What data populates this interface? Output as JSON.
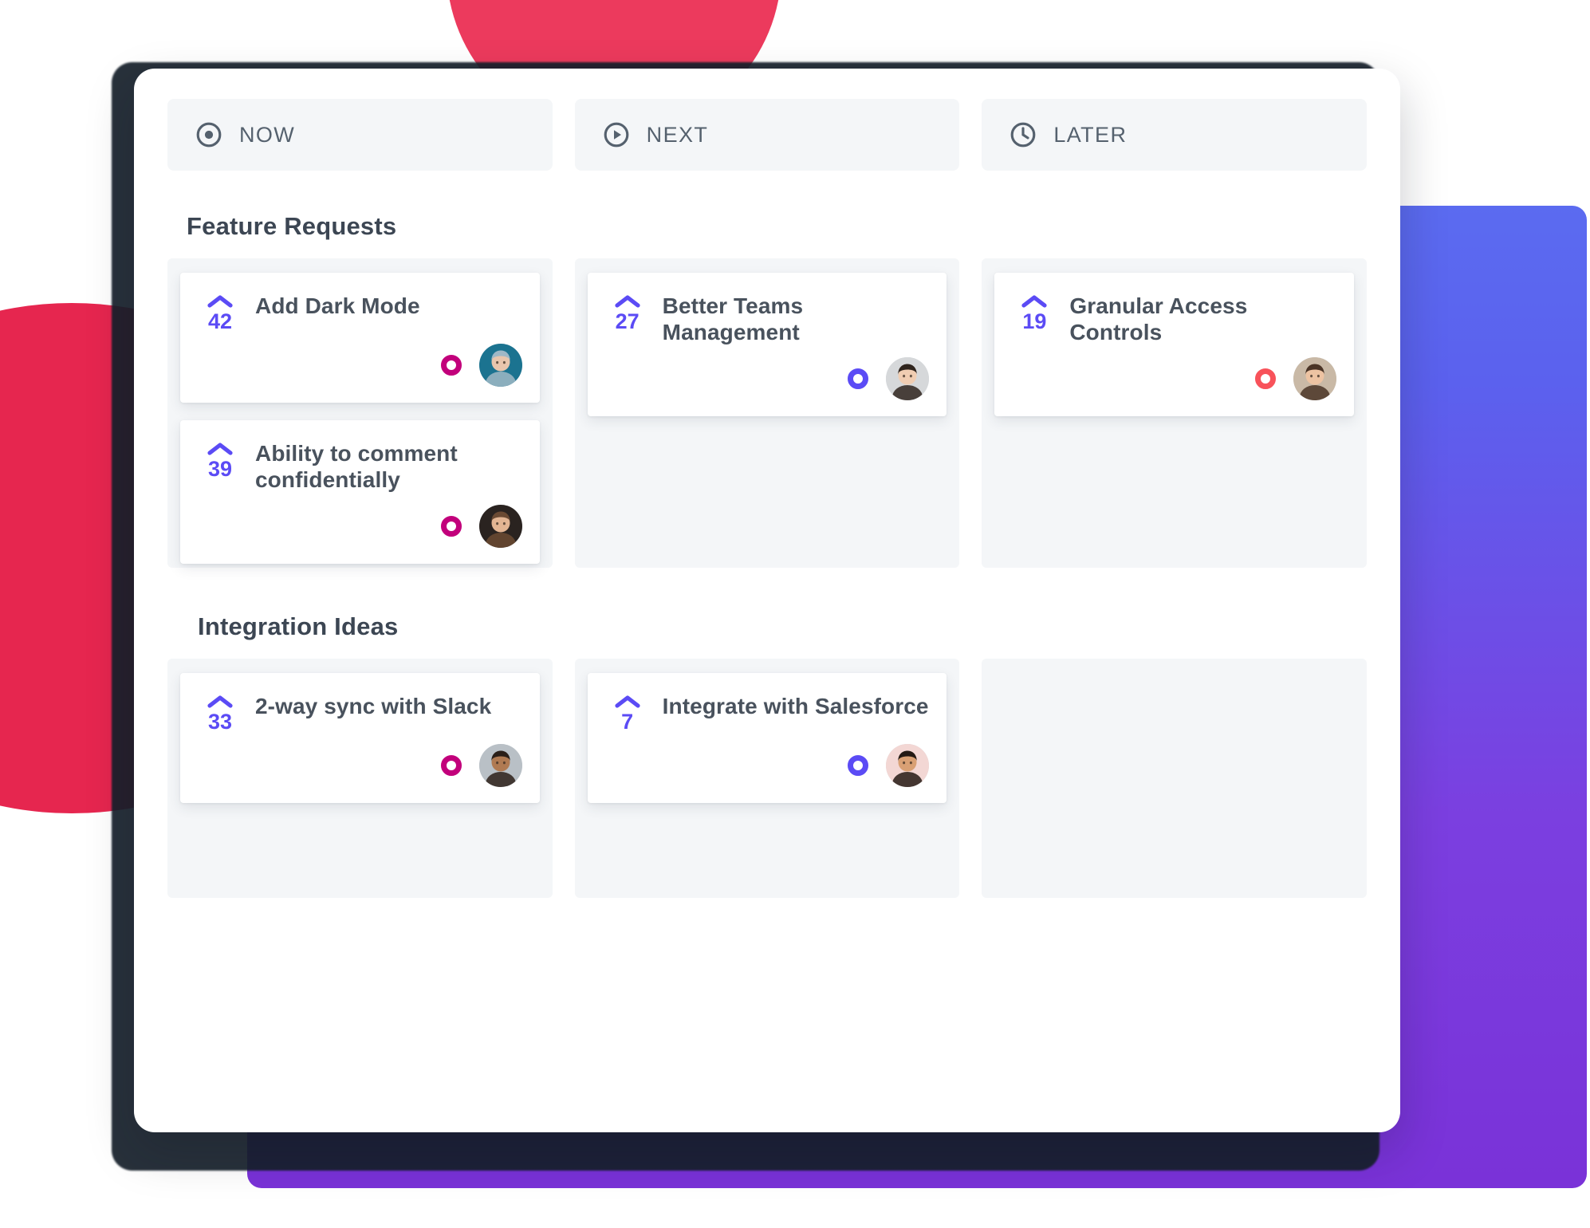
{
  "board": {
    "columns": [
      {
        "id": "now",
        "label": "NOW",
        "icon": "target-circle-icon"
      },
      {
        "id": "next",
        "label": "NEXT",
        "icon": "play-circle-icon"
      },
      {
        "id": "later",
        "label": "LATER",
        "icon": "clock-icon"
      }
    ],
    "accent_vote_color": "#5B4BF5",
    "sections": [
      {
        "title": "Feature Requests",
        "lanes": [
          {
            "column": "now",
            "cards": [
              {
                "title": "Add Dark Mode",
                "votes": "42",
                "status_color": "#C2007B",
                "avatar": "avatar-woman-denim",
                "avatar_bg": "#1B7390",
                "avatar_skin": "#e8c6ad",
                "avatar_hair": "#9fb8c6"
              },
              {
                "title": "Ability to comment confidentially",
                "votes": "39",
                "status_color": "#C2007B",
                "avatar": "avatar-woman-dark",
                "avatar_bg": "#2a2320",
                "avatar_skin": "#e3b593",
                "avatar_hair": "#6b4a33"
              }
            ]
          },
          {
            "column": "next",
            "cards": [
              {
                "title": "Better Teams Management",
                "votes": "27",
                "status_color": "#5B4BF5",
                "avatar": "avatar-man-curly",
                "avatar_bg": "#d6d8da",
                "avatar_skin": "#f0cdb2",
                "avatar_hair": "#2f241d"
              }
            ]
          },
          {
            "column": "later",
            "cards": [
              {
                "title": "Granular Access Controls",
                "votes": "19",
                "status_color": "#F8525A",
                "avatar": "avatar-man-phone",
                "avatar_bg": "#c9b9a6",
                "avatar_skin": "#edc3a2",
                "avatar_hair": "#4a3426"
              }
            ]
          }
        ]
      },
      {
        "title": "Integration Ideas",
        "lanes": [
          {
            "column": "now",
            "cards": [
              {
                "title": "2-way sync with Slack",
                "votes": "33",
                "status_color": "#C2007B",
                "avatar": "avatar-man-bearded",
                "avatar_bg": "#b9c0c6",
                "avatar_skin": "#b07a52",
                "avatar_hair": "#2b1f18"
              }
            ]
          },
          {
            "column": "next",
            "cards": [
              {
                "title": "Integrate with Salesforce",
                "votes": "7",
                "status_color": "#5B4BF5",
                "avatar": "avatar-woman-long-hair",
                "avatar_bg": "#f3d7d4",
                "avatar_skin": "#d9a074",
                "avatar_hair": "#241a14"
              }
            ]
          },
          {
            "column": "later",
            "cards": []
          }
        ]
      }
    ]
  }
}
